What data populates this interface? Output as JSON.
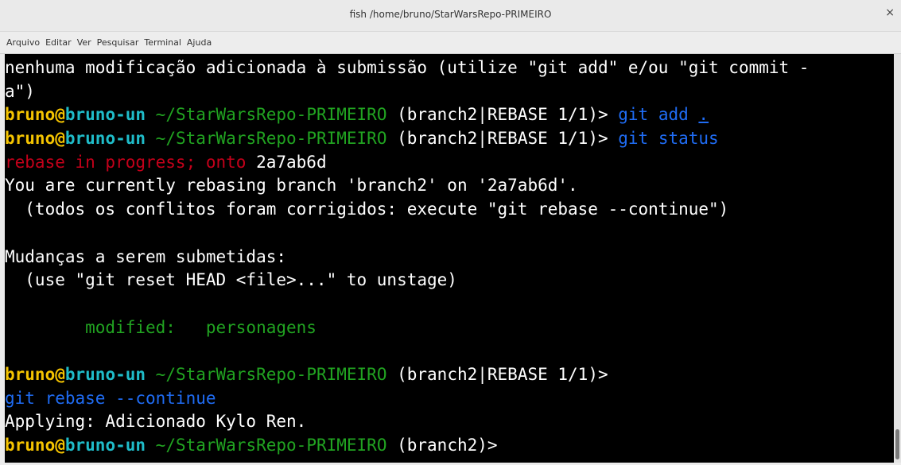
{
  "window": {
    "title": "fish  /home/bruno/StarWarsRepo-PRIMEIRO",
    "close_glyph": "×"
  },
  "menu": [
    "Arquivo",
    "Editar",
    "Ver",
    "Pesquisar",
    "Terminal",
    "Ajuda"
  ],
  "prompt": {
    "user": "bruno",
    "at": "@",
    "host": "bruno-un",
    "path": " ~/StarWarsRepo-PRIMEIRO",
    "branch_rebase": " (branch2|REBASE 1/1)> ",
    "branch_rebase_end": " (branch2|REBASE 1/1)>",
    "branch_final": " (branch2)>"
  },
  "lines": {
    "l1": "nenhuma modificação adicionada à submissão (utilize \"git add\" e/ou \"git commit -",
    "l2": "a\")",
    "cmd_add": "git add ",
    "cmd_add_arg": ".",
    "cmd_status": "git status",
    "rebase_warn": "rebase in progress; onto",
    "rebase_hash": " 2a7ab6d",
    "rebase_info": "You are currently rebasing branch 'branch2' on '2a7ab6d'.",
    "rebase_hint": "  (todos os conflitos foram corrigidos: execute \"git rebase --continue\")",
    "staged_header": "Mudanças a serem submetidas:",
    "staged_hint": "  (use \"git reset HEAD <file>...\" to unstage)",
    "modified_line": "        modified:   personagens",
    "cmd_continue": "git rebase --continue",
    "applying": "Applying: Adicionado Kylo Ren."
  },
  "colors": {
    "terminal_bg": "#000000",
    "user": "#f5c400",
    "host": "#1fbcc9",
    "path": "#21a321",
    "command": "#1f6cf4",
    "warning": "#c4001a"
  },
  "icons": {
    "close": "close-icon"
  }
}
